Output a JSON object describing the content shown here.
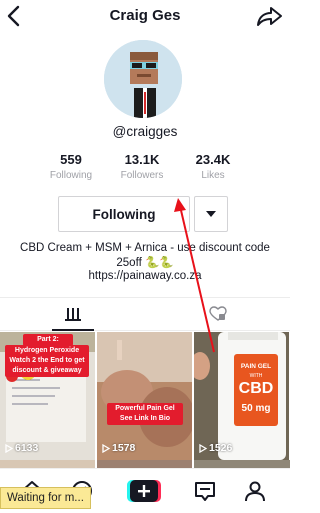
{
  "header": {
    "title": "Craig Ges"
  },
  "profile": {
    "username": "@craigges"
  },
  "stats": [
    {
      "value": "559",
      "label": "Following"
    },
    {
      "value": "13.1K",
      "label": "Followers"
    },
    {
      "value": "23.4K",
      "label": "Likes"
    }
  ],
  "actions": {
    "following_label": "Following"
  },
  "bio": {
    "text": "CBD Cream + MSM + Arnica - use discount code 25off 🐍🐍",
    "link": "https://painaway.co.za"
  },
  "videos": [
    {
      "views": "6133",
      "caption_title": "Part 2:",
      "caption": "Hydrogen Peroxide Watch 2 the End to get discount & giveaway"
    },
    {
      "views": "1578",
      "caption": "Powerful Pain Gel See Link In Bio"
    },
    {
      "views": "1526",
      "product_text": "PAIN GEL WITH CBD 50 mg"
    }
  ],
  "status_bar": {
    "text": "Waiting for m..."
  },
  "colors": {
    "accent": "#fe2c55",
    "cyan": "#25f4ee",
    "annotation_arrow": "#e8111a"
  }
}
